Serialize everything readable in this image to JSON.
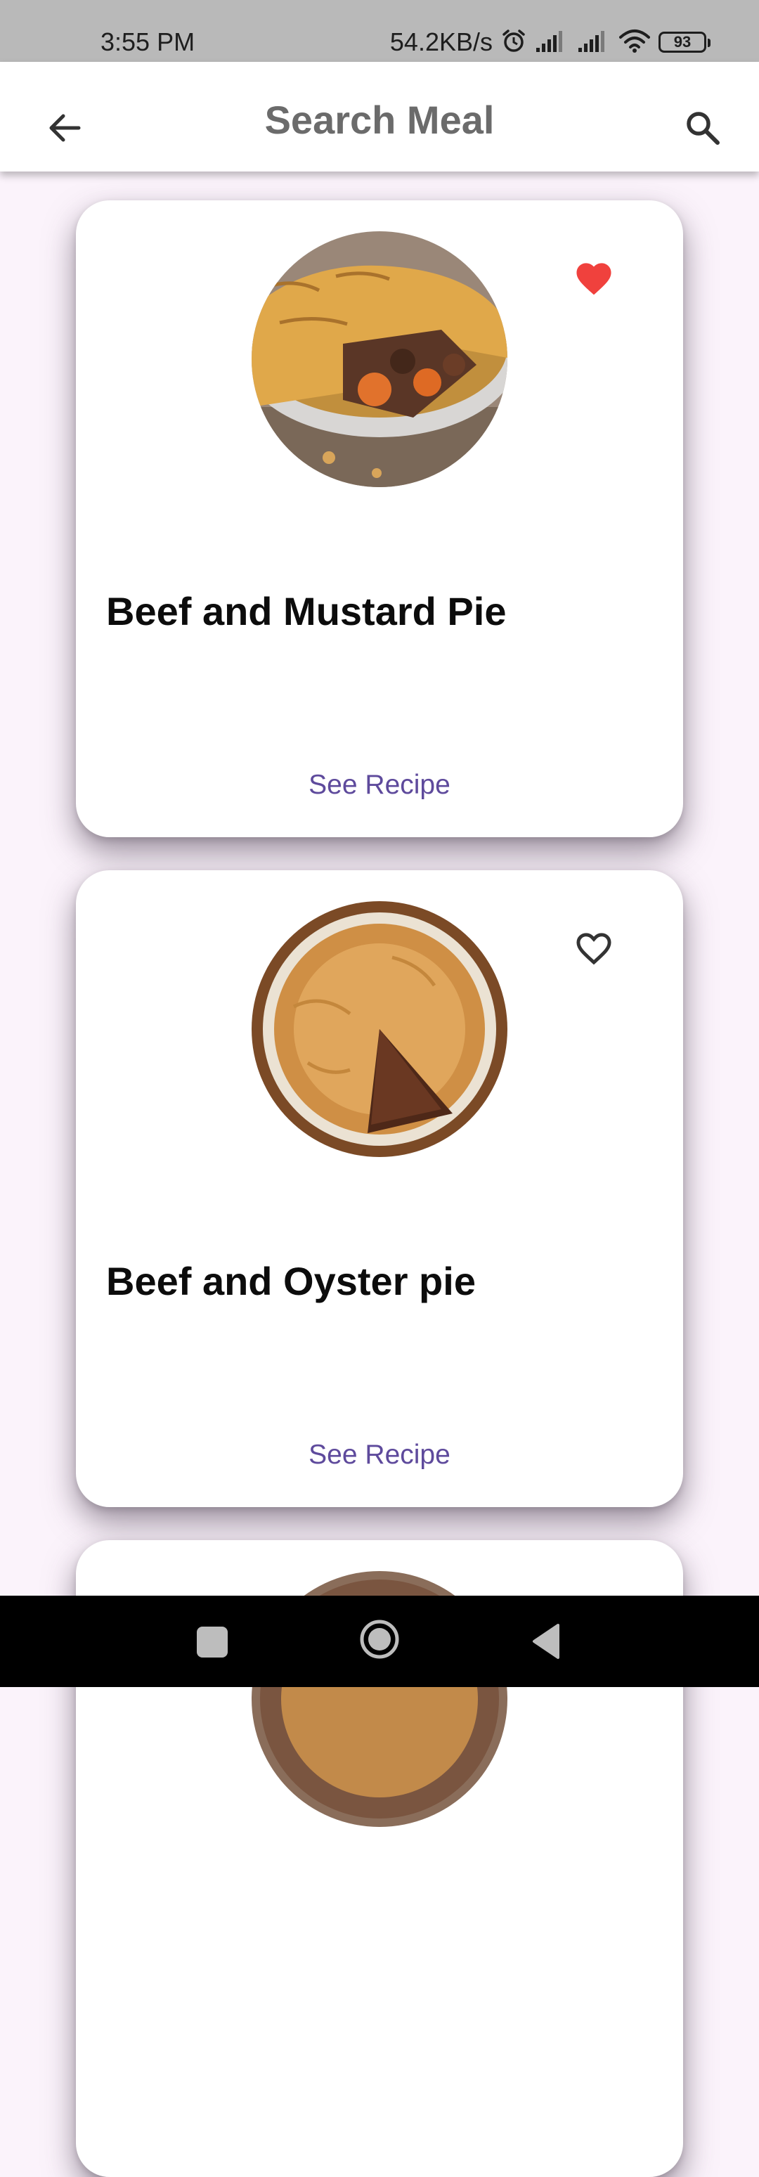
{
  "status_bar": {
    "time": "3:55 PM",
    "net_speed": "54.2KB/s",
    "battery": "93"
  },
  "app_bar": {
    "title": "Search Meal"
  },
  "meals": [
    {
      "name": "Beef and Mustard Pie",
      "favorite": true,
      "action": "See Recipe"
    },
    {
      "name": "Beef and Oyster pie",
      "favorite": false,
      "action": "See Recipe"
    }
  ],
  "colors": {
    "accent": "#5e4a9c",
    "favorite": "#f0413d",
    "background": "#fbf3fb"
  },
  "icons": {
    "back": "arrow-back-icon",
    "search": "search-icon",
    "favorite_filled": "heart-filled-icon",
    "favorite_outline": "heart-outline-icon"
  }
}
